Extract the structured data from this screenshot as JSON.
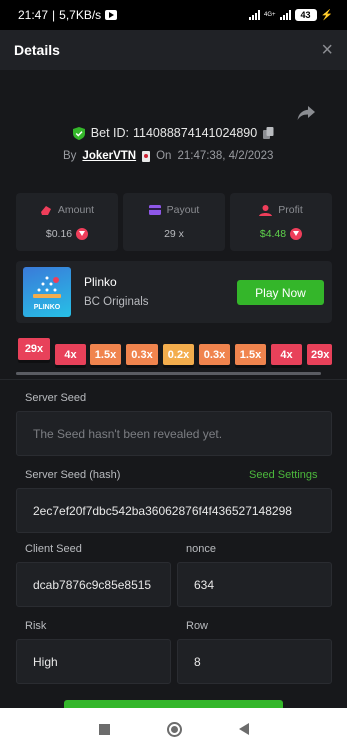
{
  "status_bar": {
    "time": "21:47",
    "speed": "5,7KB/s",
    "network": "4G+",
    "battery": "43"
  },
  "header": {
    "title": "Details",
    "close": "×"
  },
  "bet": {
    "id_label": "Bet ID:",
    "id": "114088874141024890",
    "by_label": "By",
    "user": "JokerVTN",
    "on_label": "On",
    "datetime": "21:47:38, 4/2/2023"
  },
  "stats": {
    "amount_label": "Amount",
    "amount_value": "$0.16",
    "payout_label": "Payout",
    "payout_value": "29 x",
    "profit_label": "Profit",
    "profit_value": "$4.48"
  },
  "game": {
    "name": "Plinko",
    "provider": "BC Originals",
    "play_label": "Play Now",
    "thumb_text": "PLINKO"
  },
  "multipliers": [
    "29x",
    "4x",
    "1.5x",
    "0.3x",
    "0.2x",
    "0.3x",
    "1.5x",
    "4x",
    "29x"
  ],
  "seeds": {
    "server_seed_label": "Server Seed",
    "server_seed_placeholder": "The Seed hasn't been revealed yet.",
    "server_hash_label": "Server Seed (hash)",
    "seed_settings_link": "Seed Settings",
    "server_hash_value": "2ec7ef20f7dbc542ba36062876f4f436527148298",
    "client_seed_label": "Client Seed",
    "client_seed_value": "dcab7876c9c85e8515",
    "nonce_label": "nonce",
    "nonce_value": "634",
    "risk_label": "Risk",
    "risk_value": "High",
    "row_label": "Row",
    "row_value": "8"
  },
  "colors": {
    "background": "#17181b",
    "panel": "#202226",
    "accent_green": "#34b62a",
    "coin_red": "#ef3e5a",
    "mult_red": "#e8415a",
    "mult_orange": "#f0844e",
    "mult_yellow": "#f3ad4d"
  },
  "icons": [
    "camera-icon",
    "signal-icon",
    "battery-icon",
    "close-icon",
    "share-icon",
    "shield-check-icon",
    "copy-icon",
    "playing-card-icon",
    "amount-icon",
    "payout-icon",
    "profit-icon",
    "coin-icon"
  ]
}
